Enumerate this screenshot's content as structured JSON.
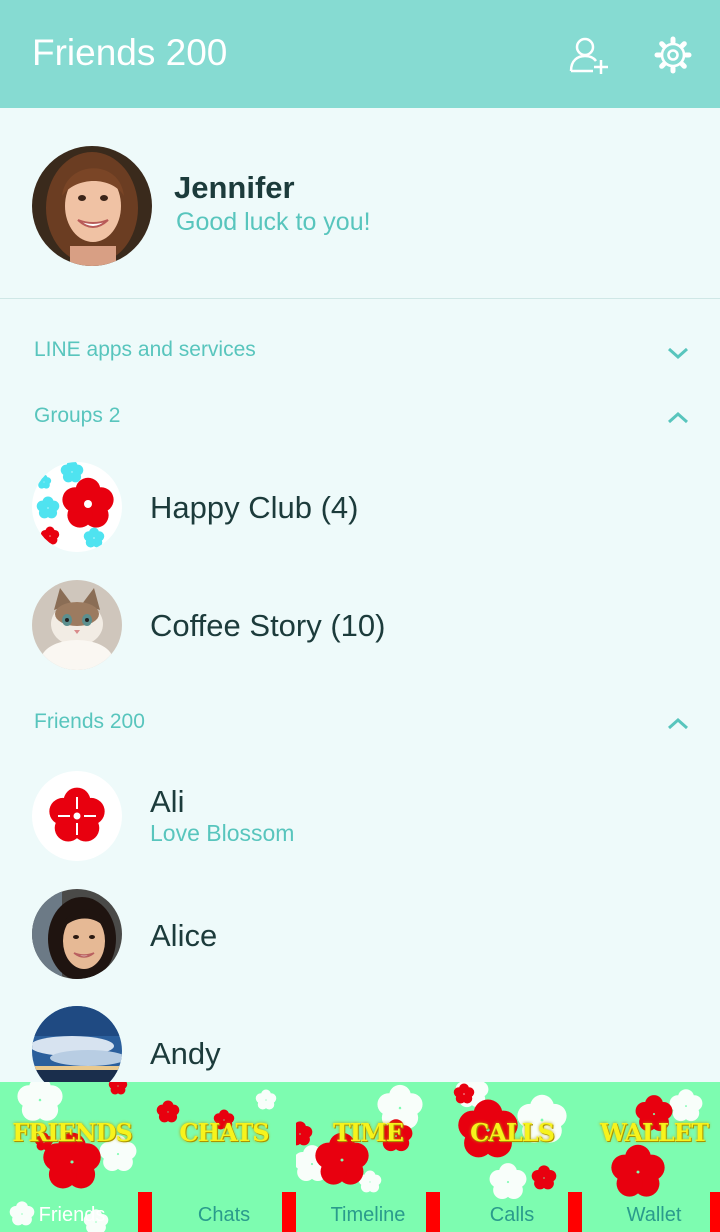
{
  "header": {
    "title": "Friends 200"
  },
  "profile": {
    "name": "Jennifer",
    "status": "Good luck to you!"
  },
  "sections": {
    "services": "LINE apps and services",
    "groups": "Groups 2",
    "friends": "Friends 200"
  },
  "groups": [
    {
      "name": "Happy Club (4)"
    },
    {
      "name": "Coffee Story (10)"
    }
  ],
  "friends": [
    {
      "name": "Ali",
      "status": "Love Blossom"
    },
    {
      "name": "Alice"
    },
    {
      "name": "Andy"
    }
  ],
  "tabs": [
    {
      "title": "FRIENDS",
      "label": "Friends"
    },
    {
      "title": "CHATS",
      "label": "Chats"
    },
    {
      "title": "TIME",
      "label": "Timeline"
    },
    {
      "title": "CALLS",
      "label": "Calls"
    },
    {
      "title": "WALLET",
      "label": "Wallet"
    }
  ],
  "colors": {
    "header": "#86dbd2",
    "accent_text": "#58c5bd",
    "tab_bg": "#7dfcb0",
    "blossom": "#e8000f"
  }
}
